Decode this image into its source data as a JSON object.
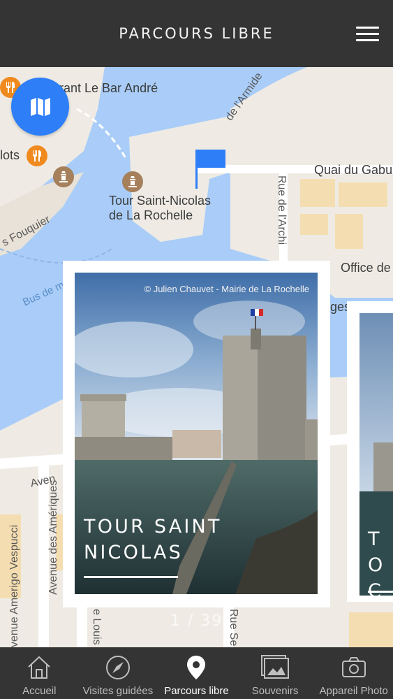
{
  "header": {
    "title": "PARCOURS LIBRE"
  },
  "map": {
    "labels": {
      "restaurant": "rant Le Bar André",
      "armide": "de l'Armide",
      "quai": "Quai du Gabu",
      "tour": "Tour Saint-Nicolas",
      "tour_line2": "de La Rochelle",
      "rue": "Rue de l'Archi",
      "office": "Office de",
      "fouquier": "s Fouquier",
      "bus": "Bus de m",
      "lots": "lots",
      "avenue": "Aven",
      "amerigo": "venue Amerigo Vespucci",
      "ameriques": "Avenue des Amériques",
      "rue_se": "Rue Se",
      "louis": "e Louis",
      "ges": "ges"
    }
  },
  "cards": [
    {
      "title": "TOUR SAINT NICOLAS",
      "credit": "© Julien Chauvet - Mairie de La Rochelle"
    },
    {
      "title_partial": "TO CH"
    }
  ],
  "pager": {
    "text": "1 / 39"
  },
  "tabbar": {
    "items": [
      {
        "label": "Accueil",
        "icon": "home-icon"
      },
      {
        "label": "Visites guidées",
        "icon": "compass-icon"
      },
      {
        "label": "Parcours libre",
        "icon": "location-pin-icon",
        "active": true
      },
      {
        "label": "Souvenirs",
        "icon": "photos-icon"
      },
      {
        "label": "Appareil Photo",
        "icon": "camera-icon"
      }
    ]
  },
  "colors": {
    "header_bg": "#343434",
    "accent_blue": "#2d7ef7",
    "water": "#a9cdf8",
    "land": "#efebe4"
  }
}
